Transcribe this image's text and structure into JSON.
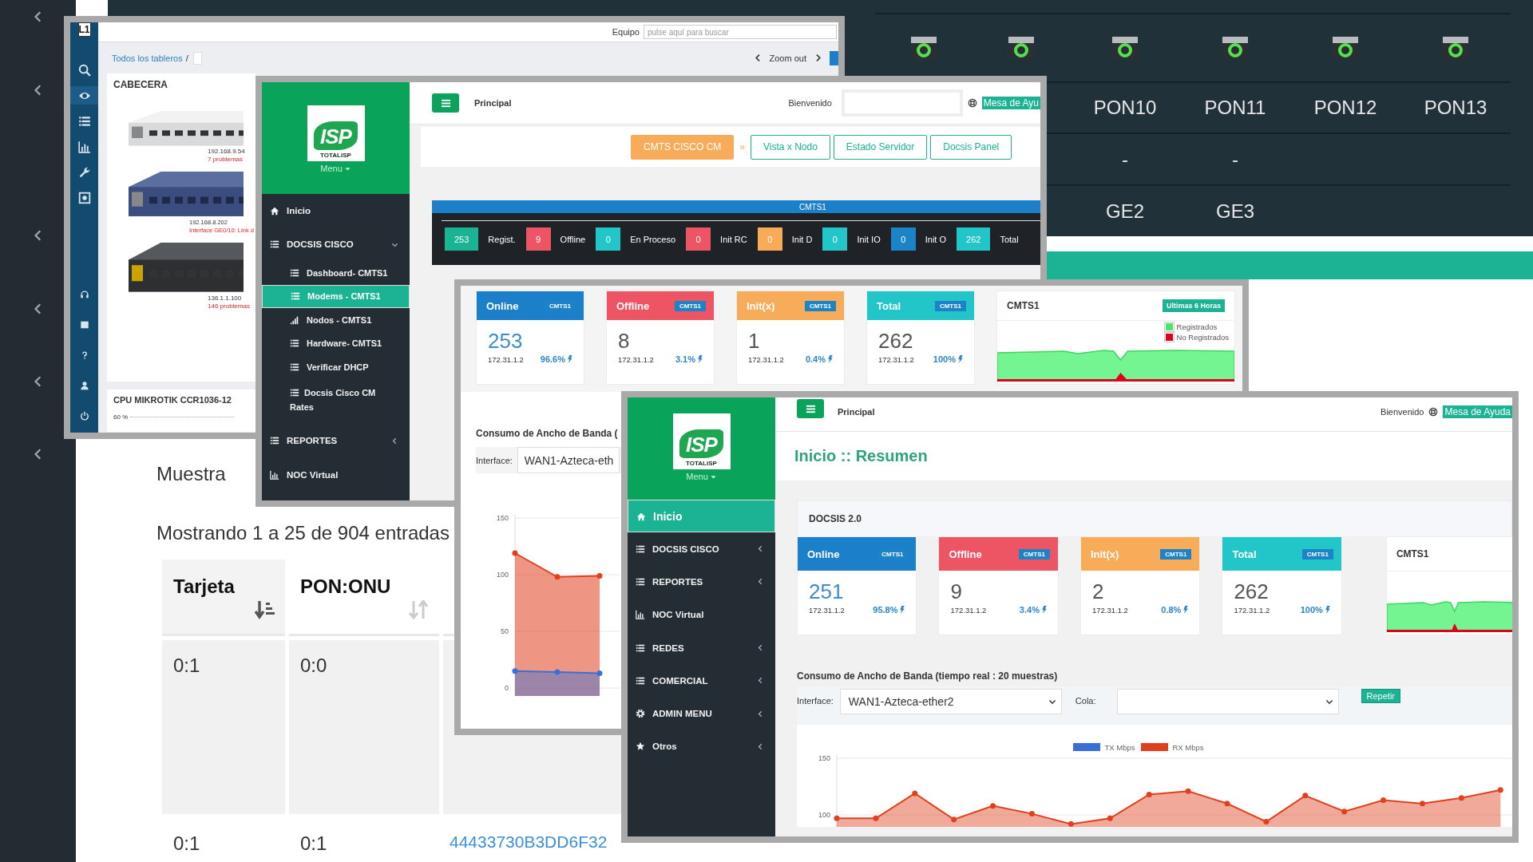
{
  "background": {
    "ports": [
      {
        "label": "PON10",
        "value": "-",
        "uplink": "GE2"
      },
      {
        "label": "PON11",
        "value": "-",
        "uplink": "GE3"
      },
      {
        "label": "PON12"
      },
      {
        "label": "PON13"
      }
    ],
    "show_label": "Muestra",
    "entries_info": "Mostrando 1 a 25 de 904 entradas",
    "table": {
      "columns": [
        {
          "label": "Tarjeta",
          "sorted": true
        },
        {
          "label": "PON:ONU",
          "sorted": false
        }
      ],
      "rows": [
        [
          "0:1",
          "0:0"
        ],
        [
          "0:1",
          "0:1",
          "44433730B3DD6F32"
        ]
      ]
    }
  },
  "monitor_window": {
    "logo": "L1",
    "nav_icons": [
      {
        "selected": false
      },
      {
        "selected": true
      },
      {
        "selected": false
      },
      {
        "selected": false
      },
      {
        "selected": false
      },
      {
        "selected": false
      },
      {
        "selected": false
      },
      {
        "selected": false
      },
      {
        "selected": false
      },
      {
        "selected": false
      },
      {
        "selected": false
      }
    ],
    "search": {
      "label": "Equipo",
      "placeholder": "pulse aquí para buscar"
    },
    "breadcrumb": {
      "link": "Todos los tableros",
      "separator": "/"
    },
    "zoom": "Zoom out",
    "header_panel": {
      "title": "CABECERA",
      "devices": [
        {
          "address": "192.168.9.54",
          "note": "7 problemas"
        },
        {
          "address": "192.168.8.202",
          "note": "Interface GE0/10: Link d"
        },
        {
          "address": "136.1.1.100",
          "note": "146 problemas"
        }
      ]
    },
    "cpu_panel": {
      "title": "CPU MIKROTIK CCR1036-12",
      "axis_label": "60 %"
    }
  },
  "cmts_window": {
    "logo": {
      "mark": "ISP",
      "caption": "TOTALISP"
    },
    "menu_label": "Menu",
    "sidebar": [
      {
        "label": "Inicio",
        "selected": false
      },
      {
        "label": "DOCSIS CISCO",
        "selected": false,
        "expanded": true,
        "children": [
          {
            "label": "Dashboard- CMTS1",
            "selected": false
          },
          {
            "label": "Modems - CMTS1",
            "selected": true
          },
          {
            "label": "Nodos - CMTS1",
            "selected": false
          },
          {
            "label": "Hardware- CMTS1",
            "selected": false
          },
          {
            "label": "Verificar DHCP",
            "selected": false
          },
          {
            "label": "Docsis Cisco CM Rates",
            "selected": false
          }
        ]
      },
      {
        "label": "REPORTES",
        "selected": false,
        "expanded": false
      },
      {
        "label": "NOC Virtual",
        "selected": false
      }
    ],
    "topbar": {
      "title": "Principal",
      "greeting": "Bienvenido",
      "help": "Mesa de Ayu"
    },
    "tabs": [
      {
        "label": "CMTS CISCO CM",
        "selected": true
      },
      {
        "label": "Vista x Nodo",
        "selected": false
      },
      {
        "label": "Estado Servidor",
        "selected": false
      },
      {
        "label": "Docsis Panel",
        "selected": false
      }
    ],
    "tab_separator": "»",
    "status": {
      "title": "CMTS1",
      "items": [
        {
          "count": "253",
          "label": "Regist.",
          "color": "#1ab394"
        },
        {
          "count": "9",
          "label": "Offline",
          "color": "#ed5565"
        },
        {
          "count": "0",
          "label": "En Proceso",
          "color": "#23c6c8"
        },
        {
          "count": "0",
          "label": "Init RC",
          "color": "#ed5565"
        },
        {
          "count": "0",
          "label": "Init D",
          "color": "#f8ac59"
        },
        {
          "count": "0",
          "label": "Init IO",
          "color": "#23c6c8"
        },
        {
          "count": "0",
          "label": "Init O",
          "color": "#1c84c6"
        },
        {
          "count": "262",
          "label": "Total",
          "color": "#23c6c8"
        }
      ]
    }
  },
  "modems_window": {
    "cards": [
      {
        "title": "Online",
        "tag": "CMTS1",
        "value": "253",
        "ip": "172.31.1.2",
        "percent": "96.6%",
        "color": "#1c7fc9",
        "highlighted": true
      },
      {
        "title": "Offline",
        "tag": "CMTS1",
        "value": "8",
        "ip": "172.31.1.2",
        "percent": "3.1%",
        "color": "#ed5565",
        "highlighted": false
      },
      {
        "title": "Init(x)",
        "tag": "CMTS1",
        "value": "1",
        "ip": "172.31.1.2",
        "percent": "0.4%",
        "color": "#f8ac59",
        "highlighted": false
      },
      {
        "title": "Total",
        "tag": "CMTS1",
        "value": "262",
        "ip": "172.31.1.2",
        "percent": "100%",
        "color": "#23c6c8",
        "highlighted": false
      }
    ],
    "graph": {
      "title": "CMTS1",
      "badge": "Ultimas 6 Horas",
      "legend": [
        {
          "label": "Registrados",
          "color": "#4fe36e"
        },
        {
          "label": "No Registrados",
          "color": "#e0001b"
        }
      ]
    },
    "bandwidth": {
      "title": "Consumo de Ancho de Banda (",
      "interface_label": "Interface:",
      "interface": "WAN1-Azteca-eth",
      "chart_data": {
        "type": "area",
        "ylim": [
          0,
          150
        ],
        "yticks": [
          0,
          50,
          100,
          150
        ],
        "series": [
          {
            "color": "#e0401d",
            "values": [
              119,
              98,
              99
            ]
          },
          {
            "color": "#3a6fd8",
            "values": [
              15,
              14,
              13
            ]
          }
        ]
      }
    }
  },
  "summary_window": {
    "logo": {
      "mark": "ISP",
      "caption": "TOTALISP"
    },
    "menu_label": "Menu",
    "sidebar": [
      {
        "label": "Inicio",
        "selected": true
      },
      {
        "label": "DOCSIS CISCO",
        "selected": false,
        "expanded": false
      },
      {
        "label": "REPORTES",
        "selected": false,
        "expanded": false
      },
      {
        "label": "NOC Virtual",
        "selected": false
      },
      {
        "label": "REDES",
        "selected": false,
        "expanded": false
      },
      {
        "label": "COMERCIAL",
        "selected": false,
        "expanded": false
      },
      {
        "label": "ADMIN MENU",
        "selected": false,
        "expanded": false
      },
      {
        "label": "Otros",
        "selected": false,
        "expanded": false
      }
    ],
    "topbar": {
      "title": "Principal",
      "greeting": "Bienvenido",
      "help": "Mesa de Ayuda"
    },
    "page_title": "Inicio :: Resumen",
    "section": "DOCSIS 2.0",
    "cards": [
      {
        "title": "Online",
        "tag": "CMTS1",
        "value": "251",
        "ip": "172.31.1.2",
        "percent": "95.8%",
        "color": "#1c7fc9",
        "highlighted": true
      },
      {
        "title": "Offline",
        "tag": "CMTS1",
        "value": "9",
        "ip": "172.31.1.2",
        "percent": "3.4%",
        "color": "#ed5565",
        "highlighted": false
      },
      {
        "title": "Init(x)",
        "tag": "CMTS1",
        "value": "2",
        "ip": "172.31.1.2",
        "percent": "0.8%",
        "color": "#f8ac59",
        "highlighted": false
      },
      {
        "title": "Total",
        "tag": "CMTS1",
        "value": "262",
        "ip": "172.31.1.2",
        "percent": "100%",
        "color": "#23c6c8",
        "highlighted": false
      }
    ],
    "graph": {
      "title": "CMTS1"
    },
    "bandwidth": {
      "title": "Consumo de Ancho de Banda (tiempo real : 20 muestras)",
      "interface_label": "Interface:",
      "interface": "WAN1-Azteca-ether2",
      "queue_label": "Cola:",
      "button": "Repetir",
      "chart_data": {
        "type": "area",
        "ylim": [
          90,
          150
        ],
        "yticks": [
          100,
          150
        ],
        "series": [
          {
            "name": "TX Mbps",
            "color": "#3a6fd8",
            "values": [
              null,
              null,
              null,
              null,
              null,
              null,
              null,
              null,
              null,
              null,
              null,
              null,
              null,
              null,
              null,
              null,
              null,
              null
            ]
          },
          {
            "name": "RX Mbps",
            "color": "#e0401d",
            "values": [
              97,
              97,
              119,
              96,
              108,
              101,
              92,
              97,
              118,
              121,
              110,
              94,
              117,
              103,
              113,
              110,
              115,
              122
            ]
          }
        ]
      }
    }
  }
}
